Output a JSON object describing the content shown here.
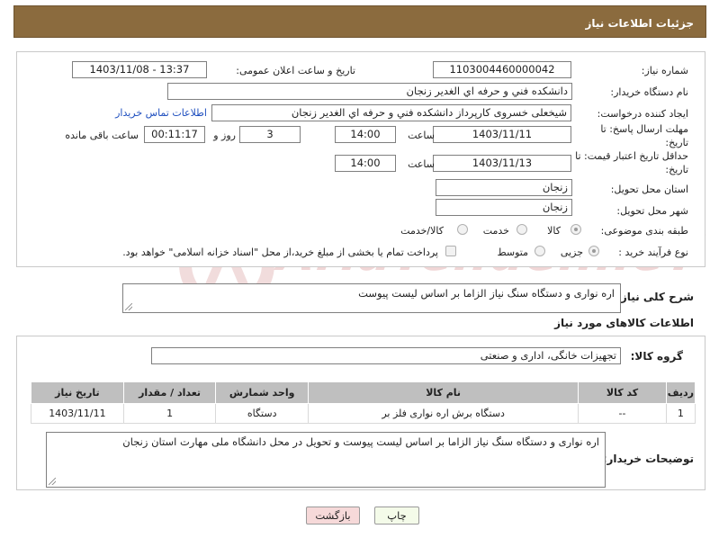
{
  "header": {
    "title": "جزئیات اطلاعات نیاز"
  },
  "form": {
    "need_number_label": "شماره نیاز:",
    "need_number": "1103004460000042",
    "announce_label": "تاریخ و ساعت اعلان عمومی:",
    "announce_value": "1403/11/08 - 13:37",
    "buyer_org_label": "نام دستگاه خریدار:",
    "buyer_org": "دانشکده فني و حرفه اي الغدير زنجان",
    "creator_label": "ایجاد کننده درخواست:",
    "creator": "شیخعلی خسروی کارپرداز دانشکده فني و حرفه اي الغدير زنجان",
    "contact_link": "اطلاعات تماس خریدار",
    "deadline_label": "مهلت ارسال پاسخ: تا تاریخ:",
    "deadline_date": "1403/11/11",
    "time_word": "ساعت",
    "deadline_time": "14:00",
    "days_value": "3",
    "days_word": "روز و",
    "remaining_time": "00:11:17",
    "remaining_word": "ساعت باقی مانده",
    "validity_label": "حداقل تاریخ اعتبار قیمت: تا تاریخ:",
    "validity_date": "1403/11/13",
    "validity_time": "14:00",
    "province_label": "استان محل تحویل:",
    "province": "زنجان",
    "city_label": "شهر محل تحویل:",
    "city": "زنجان",
    "category_label": "طبقه بندی موضوعی:",
    "category_options": [
      "کالا",
      "خدمت",
      "کالا/خدمت"
    ],
    "process_label": "نوع فرآیند خرید :",
    "process_options": [
      "جزیی",
      "متوسط"
    ],
    "payment_note": "پرداخت تمام یا بخشی از مبلغ خرید،از محل \"اسناد خزانه اسلامی\" خواهد بود."
  },
  "summary": {
    "label": "شرح کلی نیاز:",
    "text": "اره نواری و دستگاه سنگ  نیاز الزاما بر اساس لیست پیوست"
  },
  "goods": {
    "section_title": "اطلاعات کالاهای مورد نیاز",
    "group_label": "گروه کالا:",
    "group_value": "تجهیزات خانگی، اداری و صنعتی",
    "columns": [
      "ردیف",
      "کد کالا",
      "نام کالا",
      "واحد شمارش",
      "تعداد / مقدار",
      "تاریخ نیاز"
    ],
    "rows": [
      [
        "1",
        "--",
        "دستگاه برش اره نواری فلز بر",
        "دستگاه",
        "1",
        "1403/11/11"
      ]
    ]
  },
  "buyer_notes": {
    "label": "توضیحات خریدار:",
    "text": "اره نواری و دستگاه سنگ  نیاز الزاما بر اساس لیست پیوست  و تحویل در محل دانشگاه ملی مهارت استان زنجان"
  },
  "buttons": {
    "print": "چاپ",
    "back": "بازگشت"
  },
  "watermark": "AriaTender.neT",
  "colors": {
    "header_bg": "#8b6b3e",
    "table_header_bg": "#bfbfbf",
    "back_button_bg": "#f6d9d9",
    "print_button_bg": "#f4fbe9"
  }
}
